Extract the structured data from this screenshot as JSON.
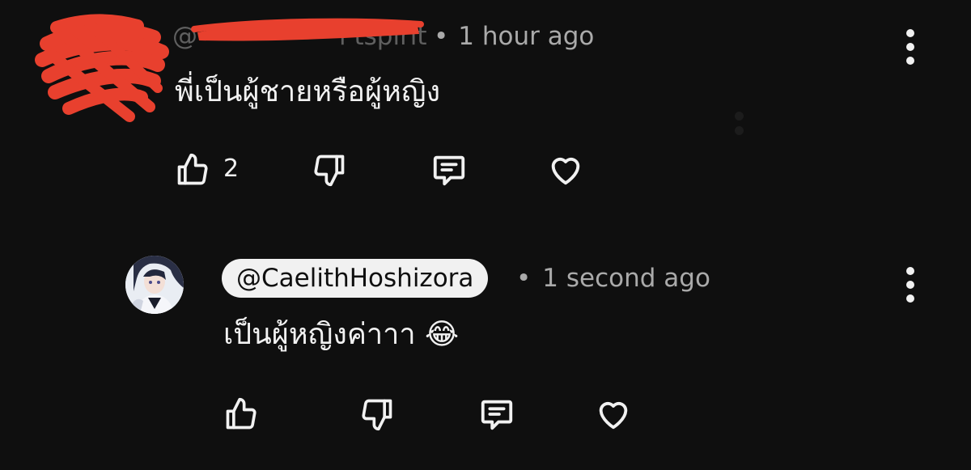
{
  "comments": [
    {
      "author_handle": "@",
      "author_handle_obscured": "l  tspirit",
      "separator": "•",
      "timestamp": "1 hour ago",
      "text": "พี่เป็นผู้ชายหรือผู้หญิง",
      "like_count": "2",
      "icons": [
        "thumbs-up-icon",
        "thumbs-down-icon",
        "reply-icon",
        "heart-icon",
        "more-vert-icon"
      ]
    },
    {
      "author_handle": "@CaelithHoshizora",
      "separator": "•",
      "timestamp": "1 second ago",
      "text": "เป็นผู้หญิงค่าาา 😂",
      "like_count": "",
      "icons": [
        "thumbs-up-icon",
        "thumbs-down-icon",
        "reply-icon",
        "heart-icon",
        "more-vert-icon"
      ]
    }
  ],
  "colors": {
    "background": "#0f0f0f",
    "text_primary": "#f1f1f1",
    "text_secondary": "#aaaaaa",
    "redaction": "#e8402e",
    "handle_pill_bg": "#f1f1f1"
  }
}
